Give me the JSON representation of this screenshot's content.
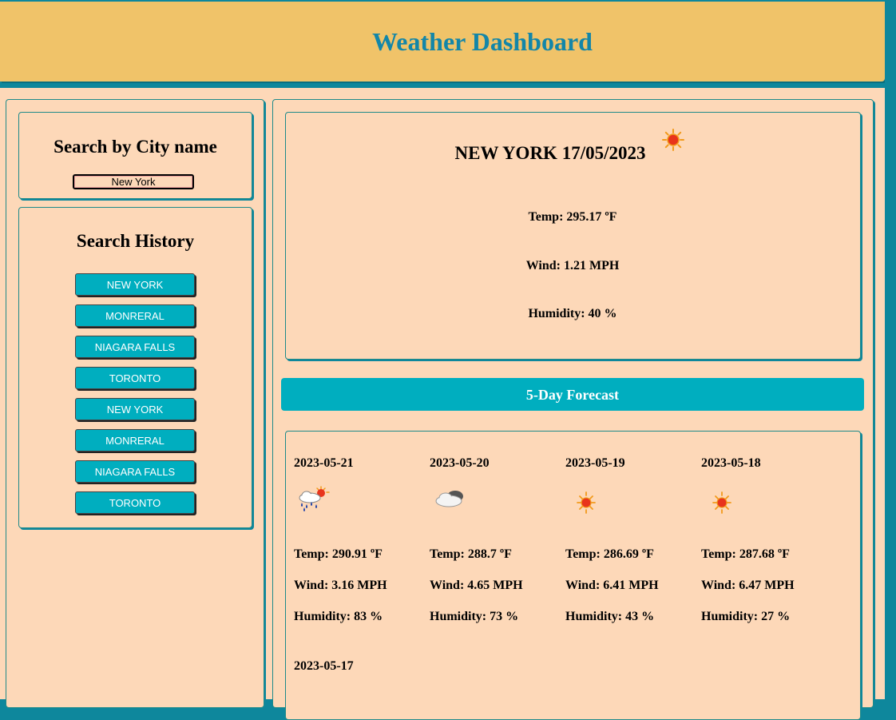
{
  "header": {
    "title": "Weather Dashboard"
  },
  "search": {
    "heading": "Search by City name",
    "value": "New York"
  },
  "history": {
    "heading": "Search History",
    "items": [
      "NEW YORK",
      "MONRERAL",
      "NIAGARA FALLS",
      "TORONTO",
      "NEW YORK",
      "MONRERAL",
      "NIAGARA FALLS",
      "TORONTO"
    ]
  },
  "current": {
    "title": "NEW YORK 17/05/2023",
    "icon": "sun-icon",
    "temp": "Temp: 295.17 ºF",
    "wind": "Wind: 1.21 MPH",
    "humidity": "Humidity: 40 %"
  },
  "forecast": {
    "heading": "5-Day Forecast",
    "days": [
      {
        "date": "2023-05-21",
        "icon": "rain-icon",
        "temp": "Temp: 290.91 ºF",
        "wind": "Wind: 3.16 MPH",
        "humidity": "Humidity: 83 %"
      },
      {
        "date": "2023-05-20",
        "icon": "cloud-icon",
        "temp": "Temp: 288.7 ºF",
        "wind": "Wind: 4.65 MPH",
        "humidity": "Humidity: 73 %"
      },
      {
        "date": "2023-05-19",
        "icon": "sun-icon",
        "temp": "Temp: 286.69 ºF",
        "wind": "Wind: 6.41 MPH",
        "humidity": "Humidity: 43 %"
      },
      {
        "date": "2023-05-18",
        "icon": "sun-icon",
        "temp": "Temp: 287.68 ºF",
        "wind": "Wind: 6.47 MPH",
        "humidity": "Humidity: 27 %"
      },
      {
        "date": "2023-05-17"
      }
    ]
  },
  "colors": {
    "header_bg": "#f0c369",
    "title": "#1386a8",
    "page_bg": "#fdd8b8",
    "accent": "#00aebf",
    "frame": "#0e879c"
  }
}
